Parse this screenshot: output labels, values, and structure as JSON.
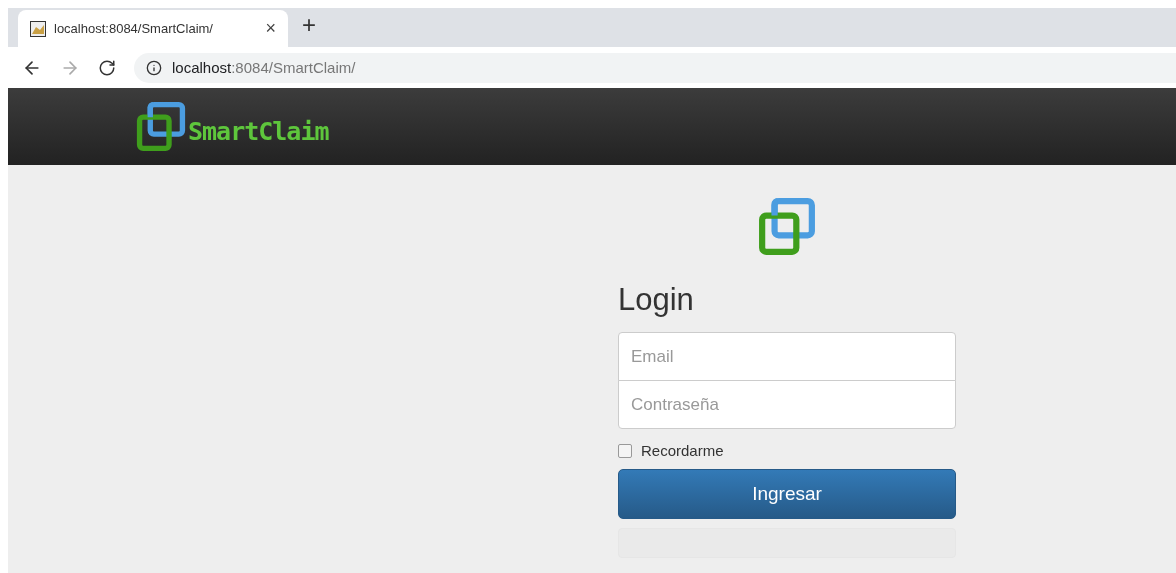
{
  "browser": {
    "tab": {
      "title": "localhost:8084/SmartClaim/",
      "close": "×",
      "new_tab": "+"
    },
    "address": {
      "host": "localhost",
      "path": ":8084/SmartClaim/"
    }
  },
  "navbar": {
    "brand": "SmartClaim"
  },
  "login": {
    "title": "Login",
    "fields": [
      {
        "placeholder": "Email"
      },
      {
        "placeholder": "Contraseña"
      }
    ],
    "remember": {
      "label": "Recordarme",
      "checked": false
    },
    "submit": "Ingresar"
  }
}
